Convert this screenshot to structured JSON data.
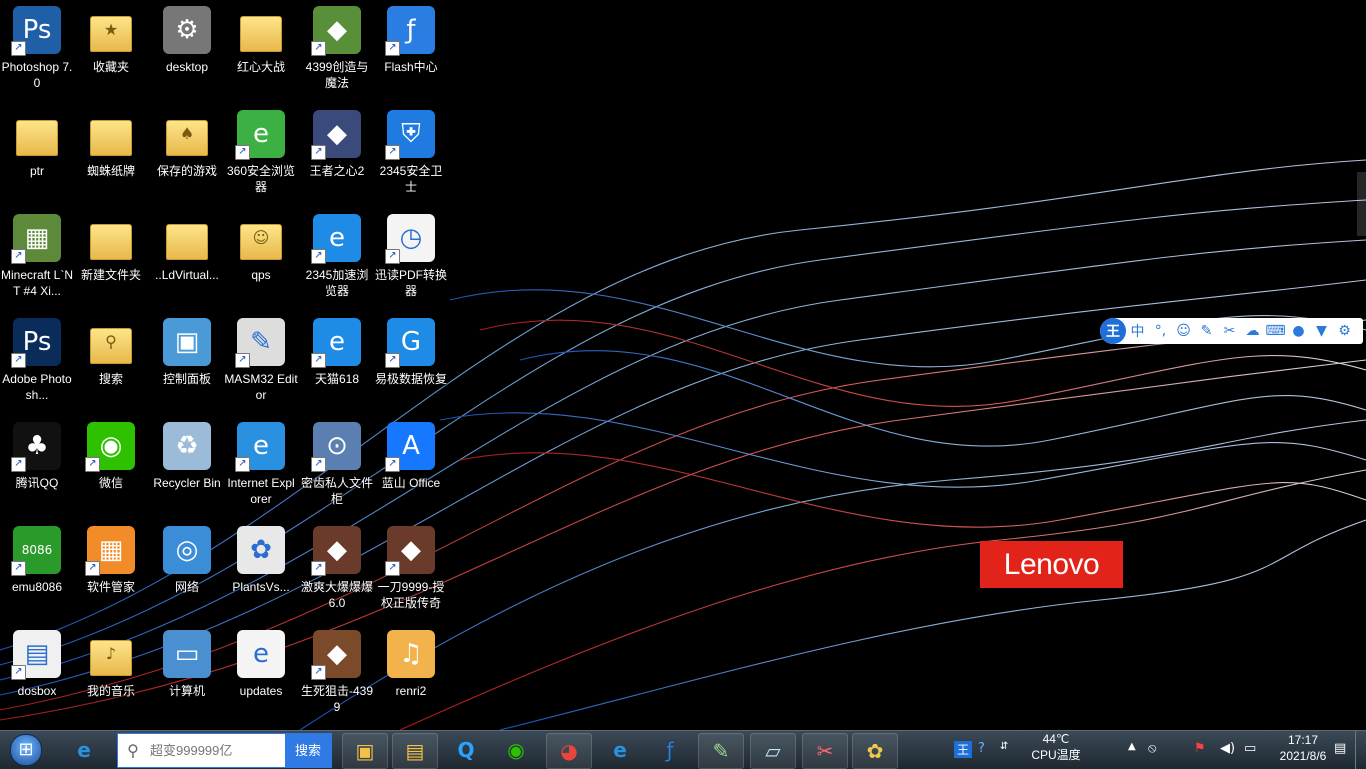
{
  "desktop_icons": [
    {
      "label": "Photoshop 7.0",
      "icon": "photoshop-icon",
      "shortcut": true,
      "color": "#1e5fa8"
    },
    {
      "label": "收藏夹",
      "icon": "favorites-folder-icon",
      "shortcut": false,
      "color": "#f2c94c"
    },
    {
      "label": "desktop",
      "icon": "system-file-icon",
      "shortcut": false,
      "color": "#777777"
    },
    {
      "label": "红心大战",
      "icon": "folder-icon",
      "shortcut": false,
      "color": "#f2c94c"
    },
    {
      "label": "4399创造与魔法",
      "icon": "game-icon",
      "shortcut": true,
      "color": "#5a8f3a"
    },
    {
      "label": "Flash中心",
      "icon": "flash-icon",
      "shortcut": true,
      "color": "#2a7de1"
    },
    {
      "label": "ptr",
      "icon": "folder-icon",
      "shortcut": false,
      "color": "#f2c94c"
    },
    {
      "label": "蜘蛛纸牌",
      "icon": "folder-icon",
      "shortcut": false,
      "color": "#f2c94c"
    },
    {
      "label": "保存的游戏",
      "icon": "saved-games-folder-icon",
      "shortcut": false,
      "color": "#f2c94c"
    },
    {
      "label": "360安全浏览器",
      "icon": "browser-360-icon",
      "shortcut": true,
      "color": "#3cb043"
    },
    {
      "label": "王者之心2",
      "icon": "game-icon",
      "shortcut": true,
      "color": "#3a4a7a"
    },
    {
      "label": "2345安全卫士",
      "icon": "shield-icon",
      "shortcut": true,
      "color": "#1f7be0"
    },
    {
      "label": "Minecraft L`NT #4 Xi...",
      "icon": "minecraft-icon",
      "shortcut": true,
      "color": "#5d8a3a"
    },
    {
      "label": "新建文件夹",
      "icon": "folder-icon",
      "shortcut": false,
      "color": "#f2c94c"
    },
    {
      "label": "..LdVirtual...",
      "icon": "folder-icon",
      "shortcut": false,
      "color": "#f2c94c"
    },
    {
      "label": "qps",
      "icon": "user-folder-icon",
      "shortcut": false,
      "color": "#f2c94c"
    },
    {
      "label": "2345加速浏览器",
      "icon": "browser-ie-icon",
      "shortcut": true,
      "color": "#1e8be6"
    },
    {
      "label": "迅读PDF转换器",
      "icon": "pdf-converter-icon",
      "shortcut": true,
      "color": "#f4f4f4"
    },
    {
      "label": "Adobe Photosh...",
      "icon": "photoshop-icon",
      "shortcut": true,
      "color": "#0a2c5a"
    },
    {
      "label": "搜索",
      "icon": "search-folder-icon",
      "shortcut": false,
      "color": "#f2c94c"
    },
    {
      "label": "控制面板",
      "icon": "control-panel-icon",
      "shortcut": false,
      "color": "#4a9ad8"
    },
    {
      "label": "MASM32 Editor",
      "icon": "editor-icon",
      "shortcut": true,
      "color": "#dddddd"
    },
    {
      "label": "天猫618",
      "icon": "browser-ie-icon",
      "shortcut": true,
      "color": "#1e8be6"
    },
    {
      "label": "易极数据恢复",
      "icon": "data-recovery-icon",
      "shortcut": true,
      "color": "#1e8be6"
    },
    {
      "label": "腾讯QQ",
      "icon": "qq-icon",
      "shortcut": true,
      "color": "#111111"
    },
    {
      "label": "微信",
      "icon": "wechat-icon",
      "shortcut": true,
      "color": "#2dc100"
    },
    {
      "label": "Recycler Bin",
      "icon": "recycle-bin-icon",
      "shortcut": false,
      "color": "#9bbbd8"
    },
    {
      "label": "Internet Explorer",
      "icon": "internet-explorer-icon",
      "shortcut": true,
      "color": "#2a90e0"
    },
    {
      "label": "密齿私人文件柜",
      "icon": "locker-icon",
      "shortcut": true,
      "color": "#5a7fb0"
    },
    {
      "label": "蓝山 Office",
      "icon": "office-icon",
      "shortcut": true,
      "color": "#1677ff"
    },
    {
      "label": "emu8086",
      "icon": "chip-icon",
      "shortcut": true,
      "color": "#2a9a2a"
    },
    {
      "label": "软件管家",
      "icon": "software-manager-icon",
      "shortcut": true,
      "color": "#f28c28"
    },
    {
      "label": "网络",
      "icon": "network-icon",
      "shortcut": false,
      "color": "#3c8dd8"
    },
    {
      "label": "PlantsVs...",
      "icon": "plant-icon",
      "shortcut": false,
      "color": "#e8e8e8"
    },
    {
      "label": "激爽大爆爆爆6.0",
      "icon": "game-icon",
      "shortcut": true,
      "color": "#6a3a2a"
    },
    {
      "label": "一刀9999-授权正版传奇",
      "icon": "game-icon",
      "shortcut": true,
      "color": "#6a3a2a"
    },
    {
      "label": "dosbox",
      "icon": "dosbox-icon",
      "shortcut": true,
      "color": "#f0f0f0"
    },
    {
      "label": "我的音乐",
      "icon": "music-folder-icon",
      "shortcut": false,
      "color": "#f2c94c"
    },
    {
      "label": "计算机",
      "icon": "computer-icon",
      "shortcut": false,
      "color": "#4a8fd0"
    },
    {
      "label": "updates",
      "icon": "ie-document-icon",
      "shortcut": false,
      "color": "#f4f4f4"
    },
    {
      "label": "生死狙击-4399",
      "icon": "game-icon",
      "shortcut": true,
      "color": "#7a4a2a"
    },
    {
      "label": "renri2",
      "icon": "wav-file-icon",
      "shortcut": false,
      "color": "#f2b24c"
    }
  ],
  "wallpaper": {
    "brand": "Lenovo",
    "brand_color": "#e2231a"
  },
  "ime_bar": {
    "logo": "王",
    "mode": "中",
    "items": [
      "punctuation-icon",
      "emoji-icon",
      "handwrite-icon",
      "scissors-icon",
      "cloud-icon",
      "keyboard-icon",
      "user-icon",
      "skin-icon",
      "settings-icon"
    ]
  },
  "taskbar": {
    "search_placeholder": "超变999999亿",
    "search_button": "搜索",
    "pinned_apps": [
      "file-manager-icon",
      "explorer-icon",
      "browser-q-icon",
      "wechat-icon",
      "chrome-icon",
      "ie-icon",
      "flash-icon",
      "code-editor-icon",
      "notes-icon",
      "snipping-icon",
      "paint-icon"
    ],
    "temperature": "44℃",
    "temperature_label": "CPU温度",
    "time": "17:17",
    "date": "2021/8/6"
  }
}
